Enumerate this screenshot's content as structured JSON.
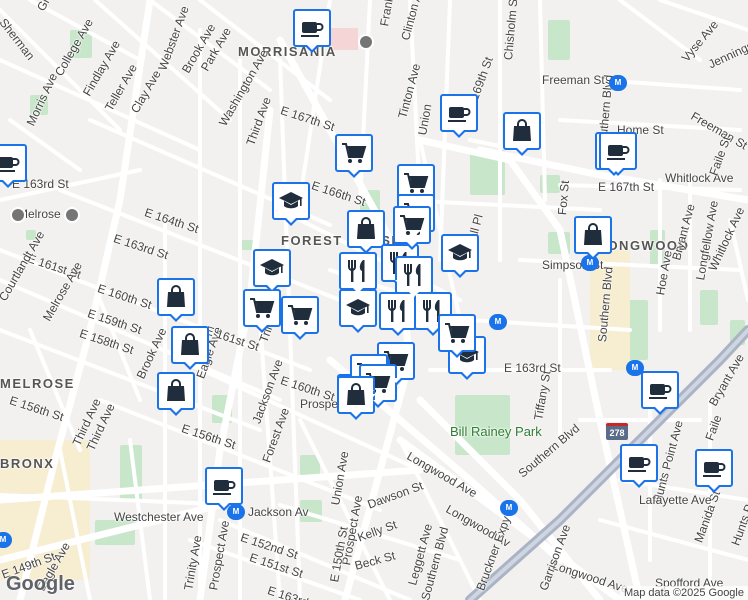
{
  "map": {
    "logo": "Google",
    "attribution": "Map data ©2025 Google",
    "colors": {
      "pin_border": "#1a73e8",
      "pin_fill": "#ffffff",
      "park": "#c8e6c9",
      "road": "#ffffff",
      "expressway": "#aab4c4"
    },
    "neighborhoods": [
      "MORRISANIA",
      "FOREST HOUSES",
      "LONGWOOD",
      "MELROSE",
      "BRONX"
    ],
    "parks": [
      "Bill Rainey Park"
    ],
    "streets": [
      "Sherman",
      "Grant Av",
      "College Ave",
      "Findlay Ave",
      "Teller Ave",
      "Clay Ave",
      "Webster Ave",
      "Brook Ave",
      "Park Ave",
      "Washington Ave",
      "Third Ave",
      "Morris Ave",
      "E 163rd St",
      "Melrose",
      "E 164th St",
      "E 161st St",
      "E 163rd St",
      "Courtlandt Ave",
      "Melrose Ave",
      "E 160th St",
      "E 159th St",
      "E 158th St",
      "Brook Ave",
      "Third Ave",
      "Eagle Ave",
      "E 161st St",
      "Trinity",
      "E 163rd St",
      "E 156th St",
      "Third Ave",
      "E 156th St",
      "Jackson Ave",
      "Forest Ave",
      "E 160th St",
      "Prospect",
      "Union Ave",
      "E 167th St",
      "E 166th St",
      "Prospect Ave",
      "Tinton Ave",
      "Union",
      "Franklin",
      "Clinton Ave",
      "E 169th St",
      "Chisholm St",
      "Freeman St",
      "Home St",
      "Southern Blvd",
      "Simpson St",
      "E 167th St",
      "Whitlock Ave",
      "Fox St",
      "Hall Pl",
      "E 163rd St",
      "Tiffany St",
      "Southern Blvd",
      "Bryant Ave",
      "Longfellow Ave",
      "Hoe Ave",
      "Vyse Ave",
      "Jennings St",
      "Freeman St",
      "Faile St",
      "Whitlock Ave",
      "Bryant Ave",
      "Hunts Point Ave",
      "Manida St",
      "Faile",
      "Lafayette Ave",
      "Hunts Point",
      "Spofford Ave",
      "Longwood Ave",
      "Longwood Av",
      "Southern Blvd",
      "Bruckner Expy",
      "Garrison Ave",
      "Longwood Ave",
      "Westchester Ave",
      "Jackson Av",
      "E 152nd St",
      "E 151st St",
      "Dawson St",
      "Kelly St",
      "Beck St",
      "Leggett Ave",
      "Southern Blvd",
      "E 149th St",
      "Eagle Ave",
      "Trinity Ave",
      "Prospect Ave",
      "E 150th St",
      "E 163rd St"
    ],
    "route_shields": [
      "278"
    ],
    "markers": [
      {
        "type": "cafe",
        "icon": "coffee-cup-icon"
      },
      {
        "type": "cafe",
        "icon": "coffee-cup-icon"
      },
      {
        "type": "cafe",
        "icon": "coffee-cup-icon"
      },
      {
        "type": "shop",
        "icon": "shopping-bag-icon"
      },
      {
        "type": "shop",
        "icon": "shopping-bag-icon"
      },
      {
        "type": "grocery",
        "icon": "shopping-cart-icon"
      },
      {
        "type": "cafe",
        "icon": "coffee-cup-icon"
      },
      {
        "type": "school",
        "icon": "graduation-cap-icon"
      },
      {
        "type": "grocery",
        "icon": "shopping-cart-icon"
      },
      {
        "type": "grocery",
        "icon": "shopping-cart-icon"
      },
      {
        "type": "shop",
        "icon": "shopping-bag-icon"
      },
      {
        "type": "shop",
        "icon": "shopping-bag-icon"
      },
      {
        "type": "school",
        "icon": "graduation-cap-icon"
      },
      {
        "type": "grocery",
        "icon": "shopping-cart-icon"
      },
      {
        "type": "grocery",
        "icon": "shopping-cart-icon"
      },
      {
        "type": "shop",
        "icon": "shopping-bag-icon"
      },
      {
        "type": "shop",
        "icon": "shopping-bag-icon"
      },
      {
        "type": "shop",
        "icon": "shopping-bag-icon"
      },
      {
        "type": "school",
        "icon": "graduation-cap-icon"
      },
      {
        "type": "restaurant",
        "icon": "fork-knife-icon"
      },
      {
        "type": "restaurant",
        "icon": "fork-knife-icon"
      },
      {
        "type": "grocery",
        "icon": "shopping-cart-icon"
      },
      {
        "type": "restaurant",
        "icon": "fork-knife-icon"
      },
      {
        "type": "school",
        "icon": "graduation-cap-icon"
      },
      {
        "type": "restaurant",
        "icon": "fork-knife-icon"
      },
      {
        "type": "restaurant",
        "icon": "fork-knife-icon"
      },
      {
        "type": "grocery",
        "icon": "shopping-cart-icon"
      },
      {
        "type": "grocery",
        "icon": "shopping-cart-icon"
      },
      {
        "type": "grocery",
        "icon": "shopping-cart-icon"
      },
      {
        "type": "school",
        "icon": "graduation-cap-icon"
      },
      {
        "type": "grocery",
        "icon": "shopping-cart-icon"
      },
      {
        "type": "grocery",
        "icon": "shopping-cart-icon"
      },
      {
        "type": "grocery",
        "icon": "shopping-cart-icon"
      },
      {
        "type": "shop",
        "icon": "shopping-bag-icon"
      },
      {
        "type": "cafe",
        "icon": "coffee-cup-icon"
      },
      {
        "type": "cafe",
        "icon": "coffee-cup-icon"
      },
      {
        "type": "cafe",
        "icon": "coffee-cup-icon"
      },
      {
        "type": "cafe",
        "icon": "coffee-cup-icon"
      }
    ]
  }
}
